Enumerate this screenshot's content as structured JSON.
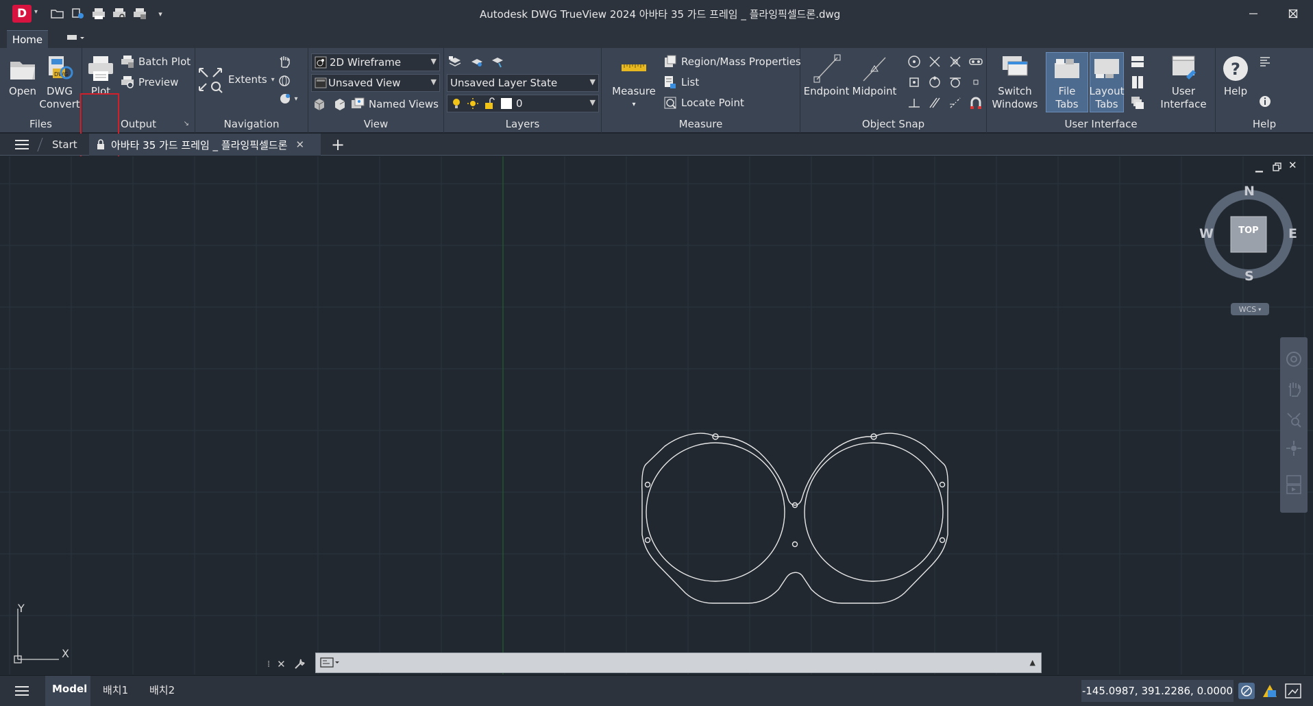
{
  "app": {
    "icon_letter": "D",
    "title": "Autodesk DWG TrueView 2024    아바타 35 가드 프레임 _ 플라잉픽셀드론.dwg"
  },
  "ribbon_tabs": {
    "home": "Home"
  },
  "ribbon": {
    "files": {
      "title": "Files",
      "open": "Open",
      "dwg_convert_line1": "DWG",
      "dwg_convert_line2": "Convert"
    },
    "output": {
      "title": "Output",
      "plot": "Plot",
      "batch_plot": "Batch Plot",
      "preview": "Preview"
    },
    "navigation": {
      "title": "Navigation",
      "extents": "Extents"
    },
    "view": {
      "title": "View",
      "visual_style": "2D Wireframe",
      "saved_view": "Unsaved View",
      "named_views": "Named Views"
    },
    "layers": {
      "title": "Layers",
      "layer_state": "Unsaved Layer State",
      "current_layer": "0"
    },
    "measure": {
      "title": "Measure",
      "measure": "Measure",
      "region_mass": "Region/Mass Properties",
      "list": "List",
      "locate_point": "Locate Point"
    },
    "object_snap": {
      "title": "Object Snap",
      "endpoint": "Endpoint",
      "midpoint": "Midpoint"
    },
    "user_interface": {
      "title": "User Interface",
      "switch_windows_line1": "Switch",
      "switch_windows_line2": "Windows",
      "file_tabs": "File Tabs",
      "layout_tabs_line1": "Layout",
      "layout_tabs_line2": "Tabs",
      "user_interface_line1": "User",
      "user_interface_line2": "Interface"
    },
    "help": {
      "title": "Help",
      "help": "Help"
    }
  },
  "doc_tabs": {
    "start": "Start",
    "active_file": "아바타 35 가드 프레임 _ 플라잉픽셀드론"
  },
  "viewcube": {
    "north": "N",
    "south": "S",
    "east": "E",
    "west": "W",
    "face": "TOP",
    "ucs": "WCS"
  },
  "ucs_icon": {
    "x": "X",
    "y": "Y"
  },
  "status_bar": {
    "layouts": [
      "Model",
      "배치1",
      "배치2"
    ],
    "coordinates": "-145.0987, 391.2286, 0.0000"
  }
}
